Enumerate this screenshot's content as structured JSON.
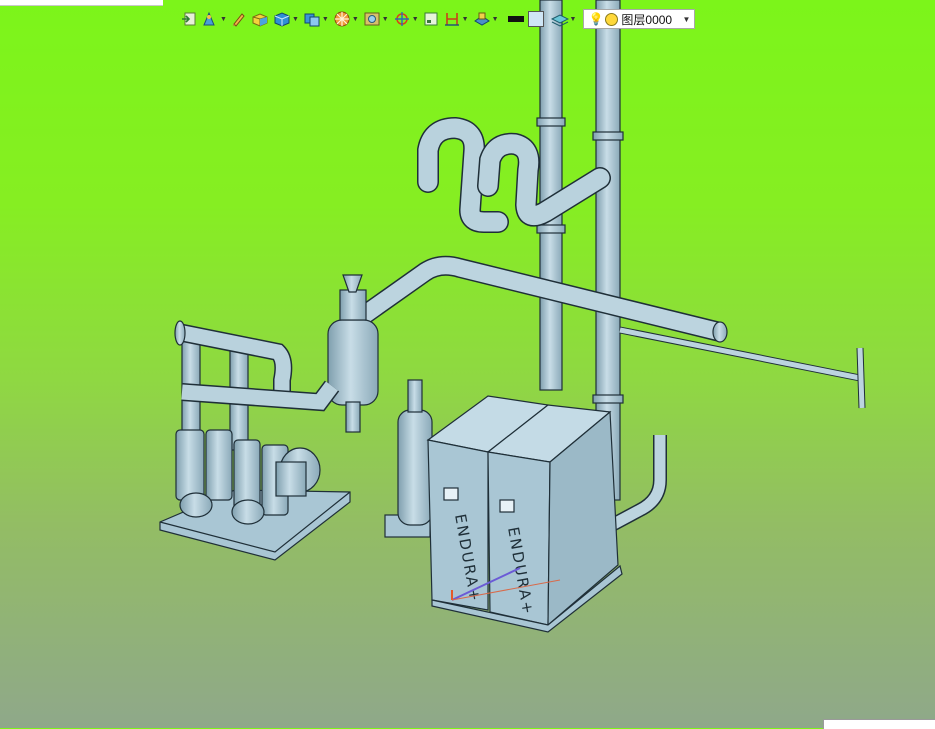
{
  "window": {
    "title_fragment": ""
  },
  "toolbar": {
    "buttons": [
      {
        "icon": "import-icon",
        "has_dropdown": false
      },
      {
        "icon": "sketch-tools-icon",
        "has_dropdown": true
      },
      {
        "icon": "pencil-icon",
        "has_dropdown": false
      },
      {
        "icon": "solid-box-icon",
        "has_dropdown": false
      },
      {
        "icon": "cube-icon",
        "has_dropdown": true
      },
      {
        "icon": "stack-icon",
        "has_dropdown": true
      },
      {
        "icon": "render-wheel-icon",
        "has_dropdown": true
      },
      {
        "icon": "view-frame-icon",
        "has_dropdown": true
      },
      {
        "icon": "crosshair-icon",
        "has_dropdown": true
      },
      {
        "icon": "page-icon",
        "has_dropdown": false
      },
      {
        "icon": "dimension-icon",
        "has_dropdown": true
      },
      {
        "icon": "tank-icon",
        "has_dropdown": true
      }
    ],
    "color_swatch_primary": "#111111",
    "color_swatch_secondary": "#cfe6f5",
    "layer_tool": {
      "icon": "layer-icon",
      "has_dropdown": true
    },
    "layer_select": {
      "value": "图层0000",
      "bulb_icon": "lightbulb-icon",
      "state_color": "#ffd83a"
    }
  },
  "model": {
    "equipment_label_1": "ENDURA+",
    "equipment_label_2": "ENDURA+",
    "body_color": "#a9c6d4",
    "edge_color": "#1f2f38"
  },
  "viewport": {
    "background_top": "#7cf51a",
    "background_bottom": "#8fa88a"
  }
}
